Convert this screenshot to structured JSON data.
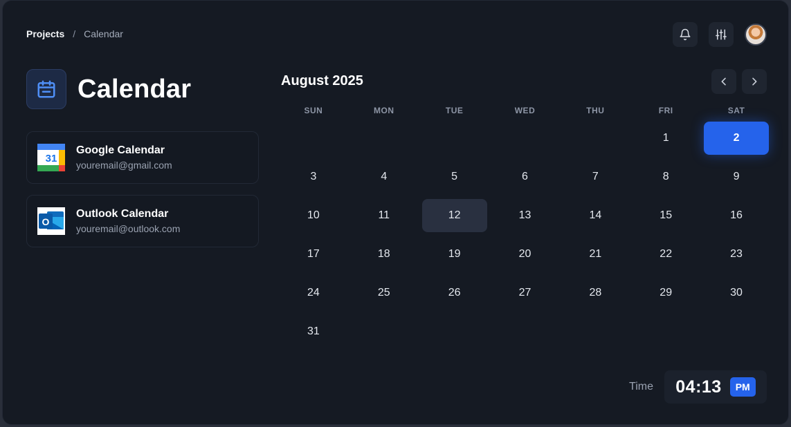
{
  "breadcrumb": {
    "root": "Projects",
    "separator": "/",
    "current": "Calendar"
  },
  "header": {
    "icons": [
      "bell-icon",
      "sliders-icon"
    ],
    "avatar": "user-avatar"
  },
  "page": {
    "title": "Calendar",
    "icon": "calendar-icon"
  },
  "accounts": [
    {
      "name": "Google Calendar",
      "email": "youremail@gmail.com",
      "icon": "google-calendar-icon",
      "icon_text": "31"
    },
    {
      "name": "Outlook Calendar",
      "email": "youremail@outlook.com",
      "icon": "outlook-icon",
      "icon_text": "O"
    }
  ],
  "calendar": {
    "month_label": "August 2025",
    "weekdays": [
      "SUN",
      "MON",
      "TUE",
      "WED",
      "THU",
      "FRI",
      "SAT"
    ],
    "first_weekday_index": 5,
    "days_in_month": 31,
    "selected_day": 2,
    "highlighted_day": 12,
    "nav": [
      "chevron-left-icon",
      "chevron-right-icon"
    ]
  },
  "time": {
    "label": "Time",
    "value": "04:13",
    "period": "PM"
  },
  "colors": {
    "accent": "#2563eb",
    "background": "#151a23",
    "surface": "#1f2530"
  }
}
